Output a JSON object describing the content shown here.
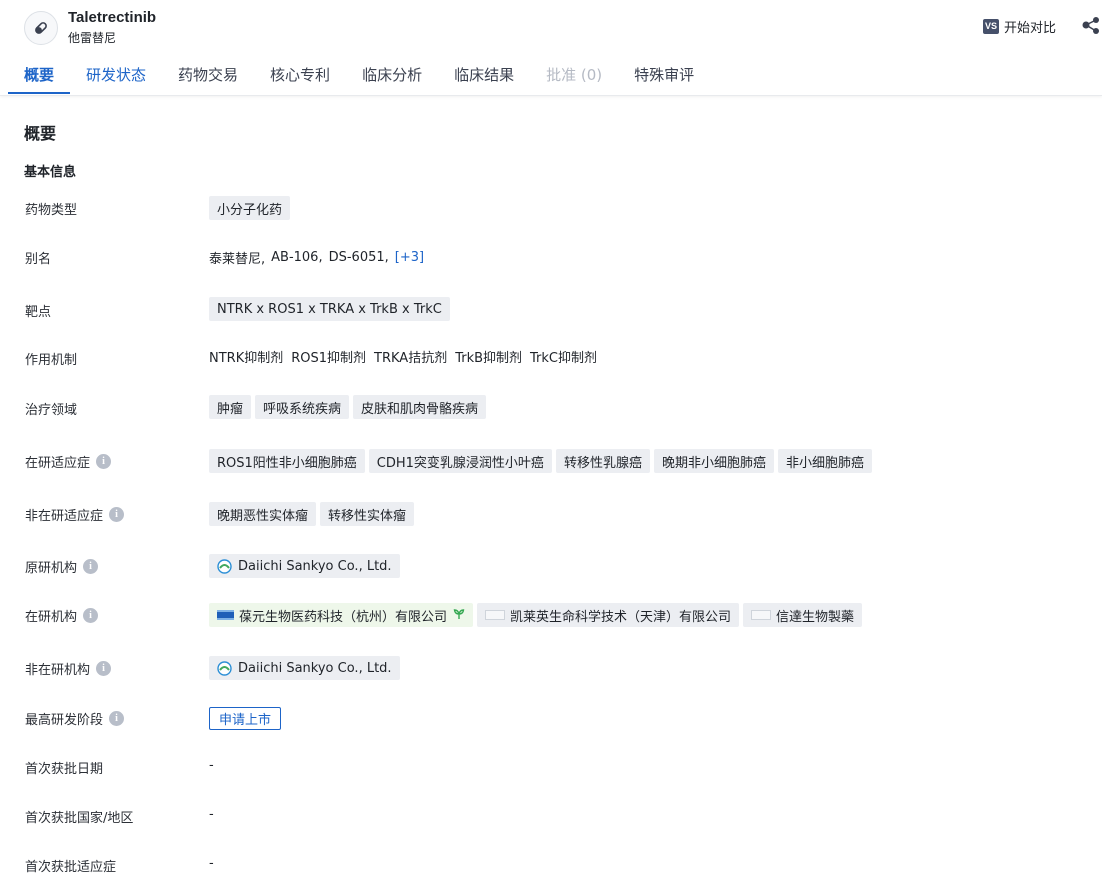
{
  "drug": {
    "name": "Taletrectinib",
    "subtitle": "他雷替尼"
  },
  "header": {
    "compare_badge": "VS",
    "compare_label": "开始对比"
  },
  "tabs": [
    {
      "label": "概要"
    },
    {
      "label": "研发状态"
    },
    {
      "label": "药物交易"
    },
    {
      "label": "核心专利"
    },
    {
      "label": "临床分析"
    },
    {
      "label": "临床结果"
    },
    {
      "label": "批准 (0)"
    },
    {
      "label": "特殊审评"
    }
  ],
  "section_title": "概要",
  "subsection_title": "基本信息",
  "info_glyph": "i",
  "fields": {
    "drug_type": {
      "label": "药物类型",
      "tags": [
        "小分子化药"
      ]
    },
    "alias": {
      "label": "别名",
      "values": [
        "泰莱替尼,",
        "AB-106,",
        "DS-6051,"
      ],
      "more": "[+3]"
    },
    "target": {
      "label": "靶点",
      "tags": [
        "NTRK x ROS1 x TRKA x TrkB x TrkC"
      ]
    },
    "mechanism": {
      "label": "作用机制",
      "values": [
        "NTRK抑制剂",
        "ROS1抑制剂",
        "TRKA拮抗剂",
        "TrkB抑制剂",
        "TrkC抑制剂"
      ]
    },
    "therapeutic_area": {
      "label": "治疗领域",
      "tags": [
        "肿瘤",
        "呼吸系统疾病",
        "皮肤和肌肉骨骼疾病"
      ]
    },
    "active_indication": {
      "label": "在研适应症",
      "tags": [
        "ROS1阳性非小细胞肺癌",
        "CDH1突变乳腺浸润性小叶癌",
        "转移性乳腺癌",
        "晚期非小细胞肺癌",
        "非小细胞肺癌"
      ]
    },
    "inactive_indication": {
      "label": "非在研适应症",
      "tags": [
        "晚期恶性实体瘤",
        "转移性实体瘤"
      ]
    },
    "originator": {
      "label": "原研机构",
      "orgs": [
        "Daiichi Sankyo Co., Ltd."
      ]
    },
    "active_org": {
      "label": "在研机构",
      "orgs": [
        "葆元生物医药科技（杭州）有限公司",
        "凯莱英生命科学技术（天津）有限公司",
        "信達生物製藥"
      ]
    },
    "inactive_org": {
      "label": "非在研机构",
      "orgs": [
        "Daiichi Sankyo Co., Ltd."
      ]
    },
    "highest_phase": {
      "label": "最高研发阶段",
      "value": "申请上市"
    },
    "first_approval_date": {
      "label": "首次获批日期",
      "value": "-"
    },
    "first_approval_country": {
      "label": "首次获批国家/地区",
      "value": "-"
    },
    "first_approval_indication": {
      "label": "首次获批适应症",
      "value": "-"
    }
  },
  "colors": {
    "accent": "#1d64c8",
    "tag_bg": "#eceef2",
    "green_tag_bg": "#eef7ea"
  }
}
